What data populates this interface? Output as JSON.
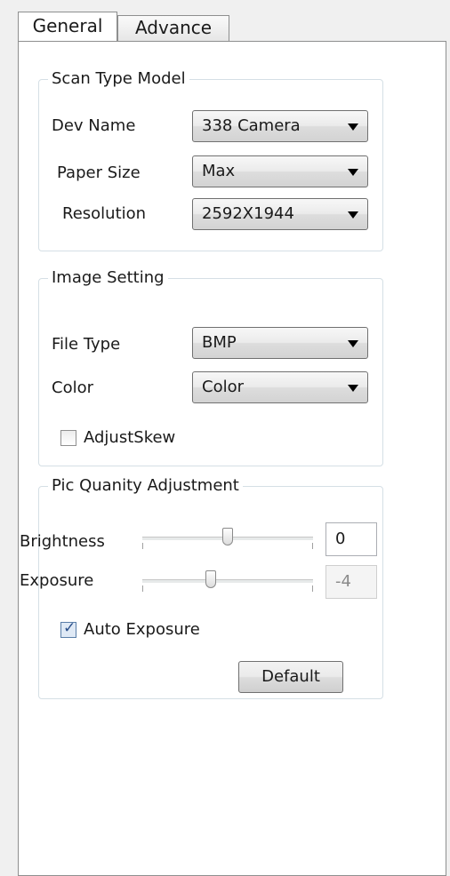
{
  "tabs": [
    {
      "label": "General",
      "active": true
    },
    {
      "label": "Advance",
      "active": false
    }
  ],
  "scan_type": {
    "title": "Scan Type Model",
    "dev_name": {
      "label": "Dev Name",
      "value": "338 Camera"
    },
    "paper_size": {
      "label": "Paper Size",
      "value": "Max"
    },
    "resolution": {
      "label": "Resolution",
      "value": "2592X1944"
    }
  },
  "image_setting": {
    "title": "Image Setting",
    "file_type": {
      "label": "File Type",
      "value": "BMP"
    },
    "color": {
      "label": "Color",
      "value": "Color"
    },
    "adjust_skew": {
      "label": "AdjustSkew",
      "checked": false
    }
  },
  "pic_quality": {
    "title": "Pic Quanity Adjustment",
    "brightness": {
      "label": "Brightness",
      "value": "0",
      "level": 0.5
    },
    "exposure": {
      "label": "Exposure",
      "value": "-4",
      "level": 0.4,
      "disabled": true
    },
    "auto_exposure": {
      "label": "Auto Exposure",
      "checked": true
    },
    "default_button": "Default"
  },
  "icons": {
    "dropdown": "chevron-down-icon",
    "check": "checkmark-icon"
  },
  "colors": {
    "panel_bg": "#ffffff",
    "window_bg": "#f0f0f0",
    "group_border": "#d5dfe5"
  }
}
